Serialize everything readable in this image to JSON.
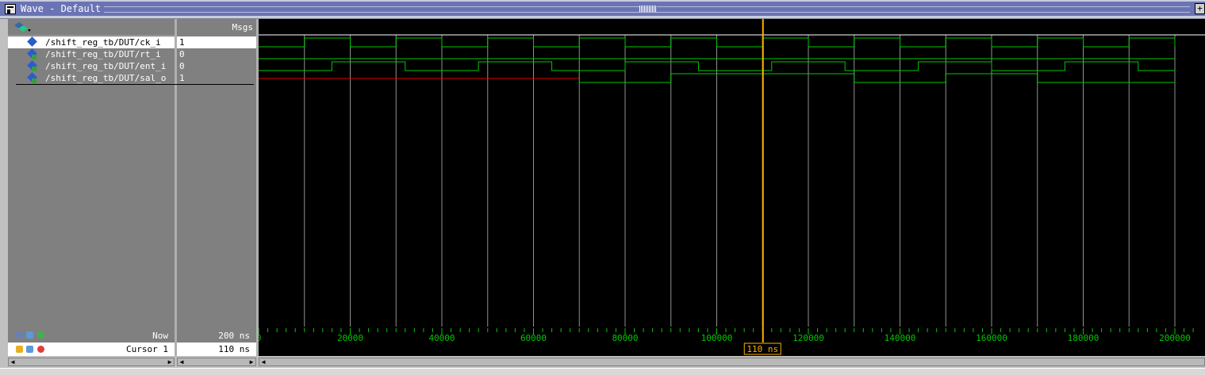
{
  "window": {
    "title": "Wave - Default"
  },
  "header": {
    "msgs_label": "Msgs"
  },
  "signals": [
    {
      "name": "/shift_reg_tb/DUT/ck_i",
      "value": "1"
    },
    {
      "name": "/shift_reg_tb/DUT/rt_i",
      "value": "0"
    },
    {
      "name": "/shift_reg_tb/DUT/ent_i",
      "value": "0"
    },
    {
      "name": "/shift_reg_tb/DUT/sal_o",
      "value": "1"
    }
  ],
  "footer": {
    "now_label": "Now",
    "now_value": "200 ns",
    "cursor_label": "Cursor 1",
    "cursor_value": "110 ns",
    "cursor_tag": "110 ns"
  },
  "timeline": {
    "ticks": [
      "0",
      "20000",
      "40000",
      "60000",
      "80000",
      "100000",
      "120000",
      "140000",
      "160000",
      "180000",
      "200000"
    ]
  },
  "colors": {
    "wave": "#00c800",
    "undefined": "#e00000",
    "cursor": "#ffb000",
    "grid": "#909090"
  },
  "chart_data": {
    "type": "waveform",
    "time_unit": "ps",
    "t_end": 200000,
    "cursor_time": 110000,
    "clock_period": 20000,
    "signals": [
      {
        "name": "/shift_reg_tb/DUT/ck_i",
        "initial": 0,
        "edges": [
          10000,
          20000,
          30000,
          40000,
          50000,
          60000,
          70000,
          80000,
          90000,
          100000,
          110000,
          120000,
          130000,
          140000,
          150000,
          160000,
          170000,
          180000,
          190000,
          200000
        ]
      },
      {
        "name": "/shift_reg_tb/DUT/rt_i",
        "initial": 0,
        "edges": []
      },
      {
        "name": "/shift_reg_tb/DUT/ent_i",
        "initial": 0,
        "edges": [
          16000,
          32000,
          48000,
          64000,
          80000,
          96000,
          112000,
          128000,
          144000,
          160000,
          176000,
          192000
        ]
      },
      {
        "name": "/shift_reg_tb/DUT/sal_o",
        "initial": "X",
        "edges": [
          70000,
          90000,
          130000,
          150000,
          170000
        ],
        "values": [
          0,
          1,
          0,
          1,
          0,
          1
        ]
      }
    ]
  }
}
